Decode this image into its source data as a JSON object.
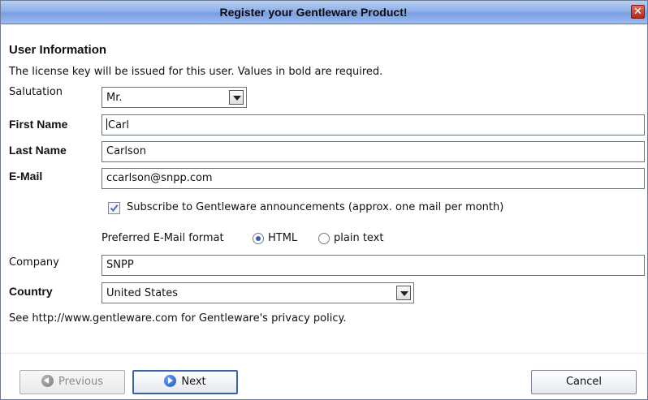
{
  "window": {
    "title": "Register your Gentleware Product!",
    "close_glyph": "✕"
  },
  "section": {
    "heading": "User Information",
    "description": "The license key will be issued for this user. Values in bold are required."
  },
  "salutation": {
    "label": "Salutation",
    "value": "Mr."
  },
  "first_name": {
    "label": "First Name",
    "value": "Carl"
  },
  "last_name": {
    "label": "Last Name",
    "value": "Carlson"
  },
  "email": {
    "label": "E-Mail",
    "value": "ccarlson@snpp.com"
  },
  "subscribe": {
    "label": "Subscribe to Gentleware announcements (approx. one mail per month)",
    "checked": true
  },
  "mail_format": {
    "label": "Preferred E-Mail format",
    "options": [
      "HTML",
      "plain text"
    ],
    "selected": "HTML"
  },
  "company": {
    "label": "Company",
    "value": "SNPP"
  },
  "country": {
    "label": "Country",
    "value": "United States"
  },
  "privacy_note": "See http://www.gentleware.com for Gentleware's privacy policy.",
  "buttons": {
    "previous": "Previous",
    "next": "Next",
    "cancel": "Cancel"
  },
  "icons": {
    "close": "close-icon",
    "checkbox_check": "checkmark-icon",
    "previous": "arrow-left-circle-icon",
    "next": "arrow-right-circle-icon",
    "dropdown": "chevron-down-icon"
  },
  "colors": {
    "title_gradient": "#8fb0e8",
    "close_button": "#b1281b",
    "accent_blue": "#3a63a8"
  }
}
